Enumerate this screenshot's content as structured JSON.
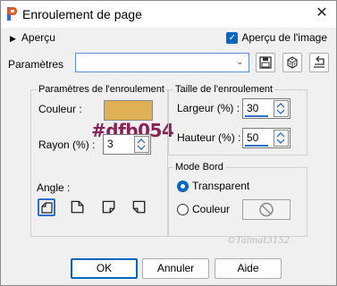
{
  "window": {
    "title": "Enroulement de page"
  },
  "top": {
    "preview_label": "Aperçu",
    "preview_image_label": "Aperçu de l'image"
  },
  "params": {
    "label": "Paramètres",
    "preset_value": ""
  },
  "curl_params": {
    "legend": "Paramètres de l'enroulement",
    "color_label": "Couleur :",
    "color_value": "#dfb054",
    "color_hex_note": "#dfb054",
    "radius_label": "Rayon (%) :",
    "radius_value": "3",
    "angle_label": "Angle :"
  },
  "curl_size": {
    "legend": "Taille de l'enroulement",
    "width_label": "Largeur (%) :",
    "width_value": "30",
    "height_label": "Hauteur (%) :",
    "height_value": "50"
  },
  "edge_mode": {
    "legend": "Mode Bord",
    "transparent_label": "Transparent",
    "color_label": "Couleur"
  },
  "buttons": {
    "ok": "OK",
    "cancel": "Annuler",
    "help": "Aide"
  },
  "watermark": "©Talmat3152"
}
